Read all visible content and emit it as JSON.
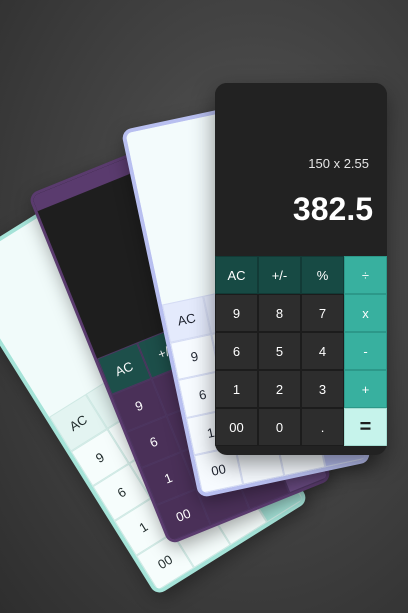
{
  "cards": {
    "mint": {
      "accent": "#a5e3d8",
      "keys": [
        "AC",
        "",
        "",
        "",
        "9",
        "",
        "",
        "",
        "6",
        "",
        "",
        "",
        "1",
        "",
        "",
        "",
        "00",
        "",
        "",
        ""
      ]
    },
    "purple": {
      "accent": "#5a3b6e",
      "keys": [
        "AC",
        "+/",
        "",
        "",
        "9",
        "",
        "",
        "",
        "6",
        "",
        "",
        "",
        "1",
        "",
        "",
        "",
        "00",
        "",
        "",
        ""
      ]
    },
    "lavender": {
      "accent": "#b8bff0",
      "keys": [
        "AC",
        "",
        "",
        "",
        "9",
        "",
        "",
        "",
        "6",
        "",
        "",
        "",
        "1",
        "",
        "",
        "",
        "00",
        "",
        "",
        ""
      ]
    },
    "front": {
      "expression": "150 x 2.55",
      "result": "382.5",
      "keys": [
        {
          "label": "AC",
          "name": "clear-button",
          "kind": "fn"
        },
        {
          "label": "+/-",
          "name": "sign-toggle-button",
          "kind": "fn"
        },
        {
          "label": "%",
          "name": "percent-button",
          "kind": "fn"
        },
        {
          "label": "÷",
          "name": "divide-button",
          "kind": "op"
        },
        {
          "label": "9",
          "name": "digit-9-button",
          "kind": "num"
        },
        {
          "label": "8",
          "name": "digit-8-button",
          "kind": "num"
        },
        {
          "label": "7",
          "name": "digit-7-button",
          "kind": "num"
        },
        {
          "label": "x",
          "name": "multiply-button",
          "kind": "op"
        },
        {
          "label": "6",
          "name": "digit-6-button",
          "kind": "num"
        },
        {
          "label": "5",
          "name": "digit-5-button",
          "kind": "num"
        },
        {
          "label": "4",
          "name": "digit-4-button",
          "kind": "num"
        },
        {
          "label": "-",
          "name": "subtract-button",
          "kind": "op"
        },
        {
          "label": "1",
          "name": "digit-1-button",
          "kind": "num"
        },
        {
          "label": "2",
          "name": "digit-2-button",
          "kind": "num"
        },
        {
          "label": "3",
          "name": "digit-3-button",
          "kind": "num"
        },
        {
          "label": "+",
          "name": "add-button",
          "kind": "op"
        },
        {
          "label": "00",
          "name": "double-zero-button",
          "kind": "num"
        },
        {
          "label": "0",
          "name": "digit-0-button",
          "kind": "num"
        },
        {
          "label": ".",
          "name": "decimal-button",
          "kind": "num"
        },
        {
          "label": "=",
          "name": "equals-button",
          "kind": "eq"
        }
      ],
      "colors": {
        "background": "#222222",
        "function_key": "#174a44",
        "operator_key": "#38b09f",
        "equals_key": "#c6f3eb"
      }
    }
  }
}
